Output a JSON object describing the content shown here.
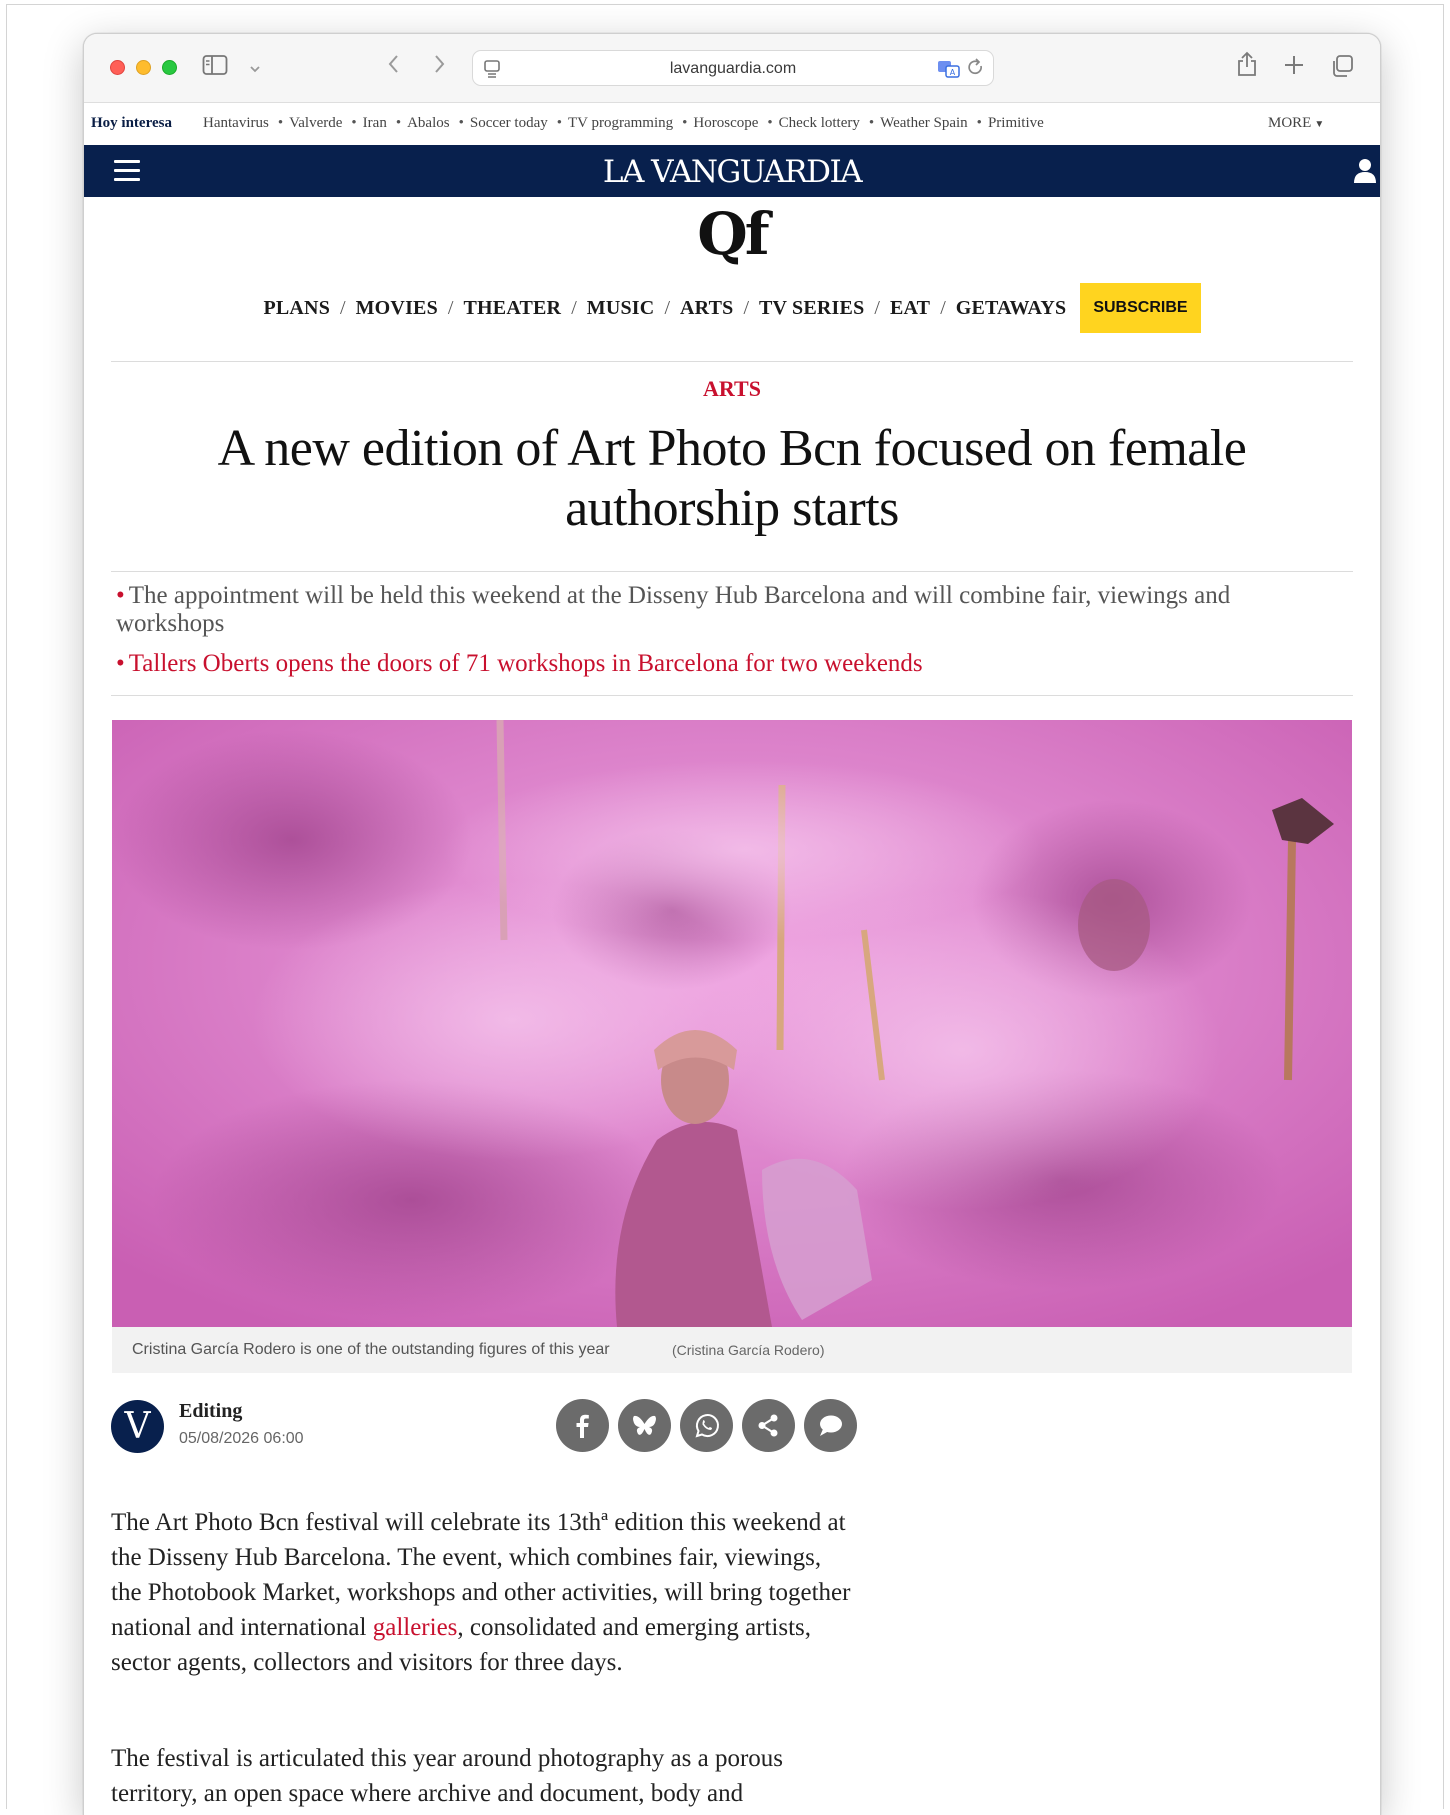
{
  "browser": {
    "url": "lavanguardia.com"
  },
  "trending": {
    "title": "Hoy interesa",
    "items": [
      "Hantavirus",
      "Valverde",
      "Iran",
      "Abalos",
      "Soccer today",
      "TV programming",
      "Horoscope",
      "Check lottery",
      "Weather Spain",
      "Primitive"
    ],
    "more_label": "MORE"
  },
  "brand": {
    "logo": "LA VANGUARDIA",
    "sublogo": "Qf"
  },
  "section_nav": {
    "items": [
      "PLANS",
      "MOVIES",
      "THEATER",
      "MUSIC",
      "ARTS",
      "TV SERIES",
      "EAT",
      "GETAWAYS"
    ],
    "subscribe_label": "SUBSCRIBE"
  },
  "article": {
    "section": "ARTS",
    "headline": "A new edition of Art Photo Bcn focused on female authorship starts",
    "leads": [
      "The appointment will be held this weekend at the Disseny Hub Barcelona and will combine fair, viewings and workshops",
      "Tallers Oberts opens the doors of 71 workshops in Barcelona for two weekends"
    ],
    "caption": "Cristina García Rodero is one of the outstanding figures of this year",
    "photo_credit": "(Cristina García Rodero)",
    "avatar_letter": "V",
    "author": "Editing",
    "date": "05/08/2026 06:00",
    "p1_before": "The Art Photo Bcn festival will celebrate its 13thª edition this weekend at the Disseny Hub Barcelona. The event, which combines fair, viewings, the Photobook Market, workshops and other activities, will bring together national and international ",
    "p1_link": "galleries",
    "p1_after": ", consolidated and emerging artists, sector agents, collectors and visitors for three days.",
    "p2": "The festival is articulated this year around photography as a porous territory, an open space where archive and document, body and landscape, memory and time, visual research and new ways of"
  },
  "colors": {
    "brand_navy": "#08204d",
    "accent_red": "#c8102e",
    "subscribe_yellow": "#ffd41f"
  },
  "icons": {
    "share": [
      "facebook-icon",
      "bluesky-icon",
      "whatsapp-icon",
      "share-icon",
      "comment-icon"
    ]
  }
}
